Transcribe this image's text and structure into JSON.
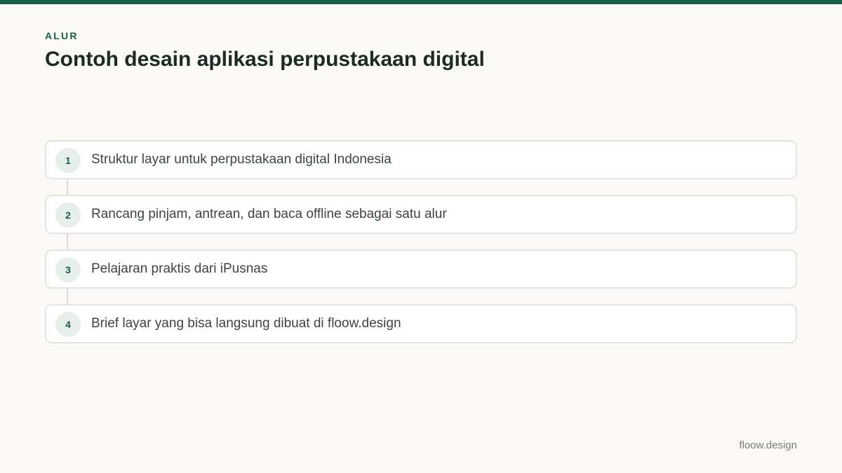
{
  "header": {
    "eyebrow": "ALUR",
    "title": "Contoh desain aplikasi perpustakaan digital"
  },
  "steps": [
    {
      "number": "1",
      "label": "Struktur layar untuk perpustakaan digital Indonesia"
    },
    {
      "number": "2",
      "label": "Rancang pinjam, antrean, dan baca offline sebagai satu alur"
    },
    {
      "number": "3",
      "label": "Pelajaran praktis dari iPusnas"
    },
    {
      "number": "4",
      "label": "Brief layar yang bisa langsung dibuat di floow.design"
    }
  ],
  "footer": {
    "brand": "floow.design"
  },
  "colors": {
    "accent": "#155e4a",
    "background": "#faf9f6",
    "card_border": "#e3e5e2",
    "badge_bg": "#e6efea"
  }
}
